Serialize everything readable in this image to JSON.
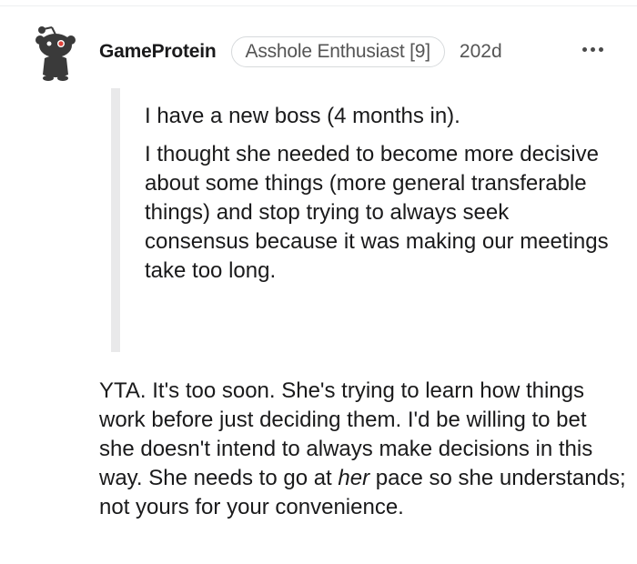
{
  "comment": {
    "author": "GameProtein",
    "flair": "Asshole Enthusiast [9]",
    "age": "202d",
    "avatar_icon": "snoo-avatar-icon",
    "more_icon": "more-options-icon",
    "quote": {
      "paragraph_1": "I have a new boss (4 months in).",
      "paragraph_2": "I thought she needed to become more decisive about some things (more general transferable things) and stop trying to always seek consensus because it was making our meetings take too long."
    },
    "reply": {
      "part_1": "YTA. It's too soon. She's trying to learn how things work before just deciding them. I'd be willing to bet she doesn't intend to always make decisions in this way. She needs to go at ",
      "emphasis": "her",
      "part_2": " pace so she understands; not yours for your convenience."
    }
  },
  "colors": {
    "text": "#1a1a1b",
    "meta": "#555555",
    "quote_bar": "#e9e9ea",
    "avatar_accent": "#e0433a"
  }
}
